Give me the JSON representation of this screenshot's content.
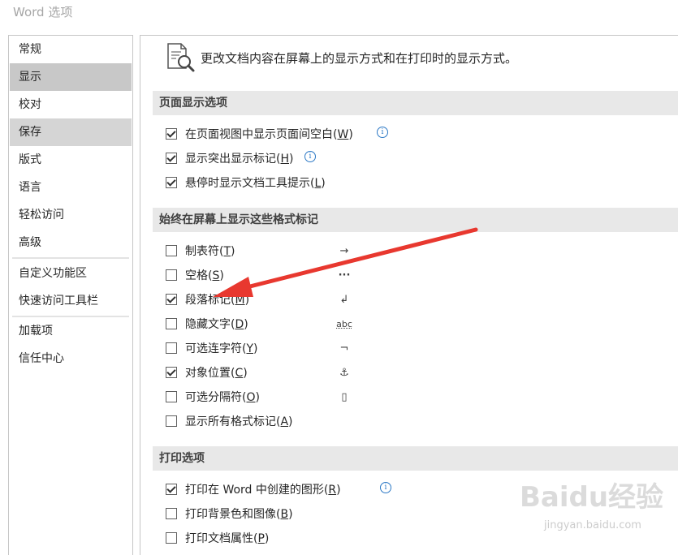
{
  "window": {
    "title": "Word 选项"
  },
  "sidebar": {
    "items": [
      {
        "label": "常规"
      },
      {
        "label": "显示"
      },
      {
        "label": "校对"
      },
      {
        "label": "保存"
      },
      {
        "label": "版式"
      },
      {
        "label": "语言"
      },
      {
        "label": "轻松访问"
      },
      {
        "label": "高级"
      },
      {
        "label": "自定义功能区"
      },
      {
        "label": "快速访问工具栏"
      },
      {
        "label": "加载项"
      },
      {
        "label": "信任中心"
      }
    ],
    "selected": "显示"
  },
  "main": {
    "header": "更改文档内容在屏幕上的显示方式和在打印时的显示方式。",
    "sections": {
      "page_display": {
        "title": "页面显示选项",
        "options": [
          {
            "text": "在页面视图中显示页面间空白",
            "key": "W",
            "checked": true,
            "info": true
          },
          {
            "text": "显示突出显示标记",
            "key": "H",
            "checked": true,
            "info": true
          },
          {
            "text": "悬停时显示文档工具提示",
            "key": "L",
            "checked": true,
            "info": false
          }
        ]
      },
      "format_marks": {
        "title": "始终在屏幕上显示这些格式标记",
        "options": [
          {
            "text": "制表符",
            "key": "T",
            "checked": false,
            "symbol": "→"
          },
          {
            "text": "空格",
            "key": "S",
            "checked": false,
            "symbol": "···"
          },
          {
            "text": "段落标记",
            "key": "M",
            "checked": true,
            "symbol": "↲"
          },
          {
            "text": "隐藏文字",
            "key": "D",
            "checked": false,
            "symbol": "abc"
          },
          {
            "text": "可选连字符",
            "key": "Y",
            "checked": false,
            "symbol": "¬"
          },
          {
            "text": "对象位置",
            "key": "C",
            "checked": true,
            "symbol": "⚓"
          },
          {
            "text": "可选分隔符",
            "key": "O",
            "checked": false,
            "symbol": "▯"
          },
          {
            "text": "显示所有格式标记",
            "key": "A",
            "checked": false,
            "symbol": ""
          }
        ]
      },
      "print": {
        "title": "打印选项",
        "options": [
          {
            "text": "打印在 Word 中创建的图形",
            "key": "R",
            "checked": true,
            "info": true
          },
          {
            "text": "打印背景色和图像",
            "key": "B",
            "checked": false,
            "info": false
          },
          {
            "text": "打印文档属性",
            "key": "P",
            "checked": false,
            "info": false
          }
        ]
      }
    }
  },
  "watermark": {
    "logo": "Baidu经验",
    "sub": "jingyan.baidu.com"
  },
  "colors": {
    "selected_nav": "#c8c8c8",
    "section_bar": "#e8e8e8",
    "arrow": "#e8382f",
    "info": "#2b78c5"
  }
}
